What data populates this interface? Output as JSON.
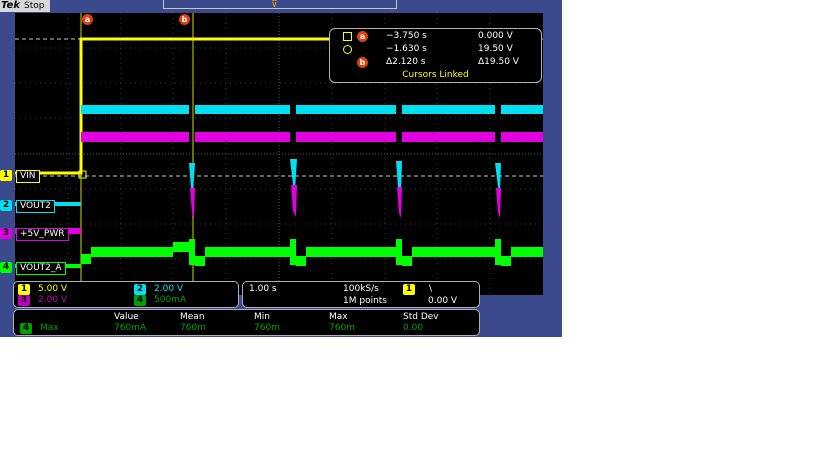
{
  "app": {
    "brand": "Tek",
    "acquisition_state": "Stop"
  },
  "channels": [
    {
      "num": "1",
      "label": "VIN",
      "color": "#ffff00",
      "scale": "5.00 V"
    },
    {
      "num": "2",
      "label": "VOUT2",
      "color": "#00e0f0",
      "scale": "2.00 V"
    },
    {
      "num": "3",
      "label": "+5V_PWR",
      "color": "#e000e0",
      "scale": "2.00 V"
    },
    {
      "num": "4",
      "label": "VOUT2_A",
      "color": "#00ff00",
      "scale": "500mA"
    }
  ],
  "cursors": {
    "a_label": "a",
    "b_label": "b",
    "a_time": "−3.750 s",
    "a_value": "0.000 V",
    "b_time": "−1.630 s",
    "b_value": "19.50 V",
    "delta_time": "Δ2.120 s",
    "delta_value": "Δ19.50 V",
    "mode": "Cursors Linked"
  },
  "horizontal": {
    "scale": "1.00 s",
    "sample_rate": "100kS/s",
    "record_length": "1M points",
    "trigger_channel": "1",
    "trigger_slope": "\\",
    "trigger_level": "0.00 V"
  },
  "measurement": {
    "headers": [
      "Value",
      "Mean",
      "Min",
      "Max",
      "Std Dev"
    ],
    "channel": "4",
    "name": "Max",
    "values": [
      "760mA",
      "760m",
      "760m",
      "760m",
      "0.00"
    ]
  }
}
